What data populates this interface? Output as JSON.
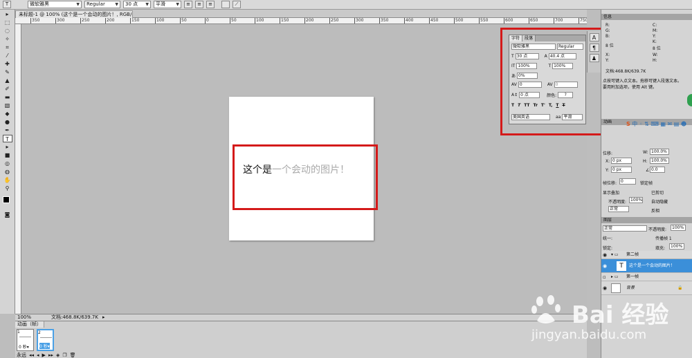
{
  "options": {
    "tool_icon": "T",
    "font_family": "微软雅黑",
    "font_style": "Regular",
    "font_size": "30 点",
    "antialias": "平滑"
  },
  "document_tab": "未标题-1 @ 100% (这个是一个会动的图片！, RGB/8) *",
  "ruler_ticks": [
    "350",
    "300",
    "250",
    "200",
    "150",
    "100",
    "50",
    "0",
    "50",
    "100",
    "150",
    "200",
    "250",
    "300",
    "350",
    "400",
    "450",
    "500",
    "550",
    "600",
    "650",
    "700",
    "750"
  ],
  "canvas_text": {
    "dark": "这个是",
    "light": "一个会动的图片！"
  },
  "status": {
    "zoom": "100%",
    "doc_info": "文档:468.8K/639.7K"
  },
  "animation": {
    "tab": "动画（帧）",
    "frames": [
      {
        "num": "1",
        "time": "0 秒▾"
      },
      {
        "num": "2",
        "time": "0 秒▾"
      }
    ],
    "loop": "永远"
  },
  "character_panel": {
    "tab_character": "字符",
    "tab_paragraph": "段落",
    "font_family": "微软雅黑",
    "font_style": "Regular",
    "size": "30 点",
    "leading": "40.4 点",
    "vscale": "100%",
    "hscale": "100%",
    "tracking_pct": "0%",
    "kerning": "0",
    "tracking": "0",
    "baseline": "0 点",
    "color_label": "颜色:",
    "style_buttons": [
      "T",
      "T",
      "TT",
      "Tr",
      "T'",
      "T,",
      "T",
      "T"
    ],
    "language": "美国英语",
    "antialias_label": "aa",
    "antialias": "平滑"
  },
  "info_panel": {
    "title": "信息",
    "r": "R:",
    "g": "G:",
    "b": "B:",
    "bit": "8 位",
    "c": "C:",
    "m": "M:",
    "y": "Y:",
    "k": "K:",
    "bit2": "8 位",
    "x": "X:",
    "yy": "Y:",
    "w": "W:",
    "h": "H:",
    "doc": "文档:468.8K/639.7K",
    "hint1": "点按可键入点文本。拖移可键入段落文本。",
    "hint2": "要用附加选项，使用 Alt 键。"
  },
  "transform_panel": {
    "title": "动画",
    "pos_label": "位移:",
    "w_label": "W:",
    "w_val": "100.0%",
    "x_label": "X:",
    "x_val": "0 px",
    "h_label": "H:",
    "h_val": "100.0%",
    "y_label": "Y:",
    "y_val": "0 px",
    "angle": "0.0",
    "frame_offset_label": "帧位移:",
    "frame_offset": "0",
    "lock_label": "锁定帧",
    "show_overlay": "显示叠加",
    "clip": "已剪切",
    "opacity_label": "不透明度:",
    "opacity": "100%",
    "auto_hide": "自动隐藏",
    "blend": "正常",
    "invert": "反相"
  },
  "layers_panel": {
    "title": "图层",
    "blend": "正常",
    "opacity_label": "不透明度:",
    "opacity": "100%",
    "unify_label": "统一:",
    "propagate": "传播帧 1",
    "lock_label": "锁定:",
    "fill_label": "填充:",
    "fill": "100%",
    "layers": [
      {
        "name": "第二帧",
        "type": "group"
      },
      {
        "name": "这个是一个会动的图片！",
        "type": "text"
      },
      {
        "name": "第一帧",
        "type": "group"
      },
      {
        "name": "背景",
        "type": "background"
      }
    ]
  },
  "watermark": {
    "brand": "Bai  经验",
    "url": "jingyan.baidu.com"
  },
  "colors": {
    "highlight": "#d41a1a",
    "selected_layer": "#3b8fd9",
    "frame_sel": "#4aa0e6"
  }
}
